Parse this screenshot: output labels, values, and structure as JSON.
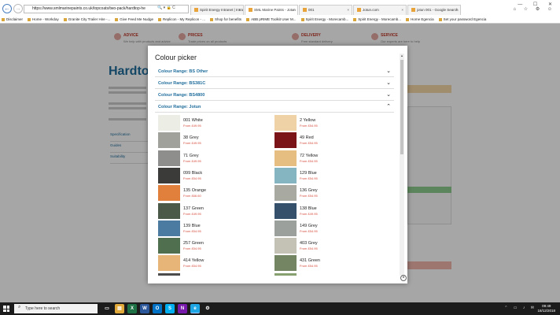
{
  "browser": {
    "url": "https://www.smlmarinepaints.co.uk/topcoats/two-pack/hardtop-he",
    "tabs": [
      {
        "label": "Spirit Energy Intranet | Intranet",
        "active": false
      },
      {
        "label": "SML Marine Paints - Jotun",
        "active": true
      },
      {
        "label": "001",
        "active": false
      },
      {
        "label": "Jotun.com",
        "active": false
      },
      {
        "label": "jotun 001 - Google Search",
        "active": false
      }
    ],
    "bookmarks": [
      "Disclaimer",
      "Home - Workday",
      "Granite City Trailer Hire -...",
      "Give Feed Me Nudge",
      "Replicon - My Replicon - ...",
      "Shop for benefits",
      "ABB pRIME Toolkit User M...",
      "Spirit Energy - Morecamb...",
      "Spirit Energy - Morecamb...",
      "Home Egencia",
      "Set your password Egencia"
    ]
  },
  "background_page": {
    "features": [
      {
        "title": "ADVICE",
        "desc": "We help with products and advice"
      },
      {
        "title": "PRICES",
        "desc": "Trade prices on all products"
      },
      {
        "title": "DELIVERY",
        "desc": "Free standard delivery"
      },
      {
        "title": "SERVICE",
        "desc": "Our experts are here to help"
      }
    ],
    "title": "Hardtop",
    "side_tabs": [
      "Specification",
      "Guides",
      "Suitability"
    ]
  },
  "modal": {
    "title": "Colour picker",
    "ranges": [
      {
        "label": "Colour Range: BS Other",
        "expanded": false
      },
      {
        "label": "Colour Range: BS381C",
        "expanded": false
      },
      {
        "label": "Colour Range: BS4800",
        "expanded": false
      },
      {
        "label": "Colour Range: Jotun",
        "expanded": true
      }
    ],
    "colours": [
      {
        "name": "001 White",
        "price": "From £49.95",
        "hex": "#ecede4"
      },
      {
        "name": "2 Yellow",
        "price": "From £54.95",
        "hex": "#efd3a6"
      },
      {
        "name": "38 Grey",
        "price": "From £49.95",
        "hex": "#9fa19a"
      },
      {
        "name": "49 Red",
        "price": "From £54.95",
        "hex": "#7a1418"
      },
      {
        "name": "71 Grey",
        "price": "From £49.95",
        "hex": "#8e8f8c"
      },
      {
        "name": "72 Yellow",
        "price": "From £54.95",
        "hex": "#e6be82"
      },
      {
        "name": "099 Black",
        "price": "From £54.95",
        "hex": "#3b3b39"
      },
      {
        "name": "129 Blue",
        "price": "From £54.95",
        "hex": "#85b5c0"
      },
      {
        "name": "135 Orange",
        "price": "From £66.60",
        "hex": "#e0803c"
      },
      {
        "name": "136 Grey",
        "price": "From £54.95",
        "hex": "#a8aaa2"
      },
      {
        "name": "137 Green",
        "price": "From £49.95",
        "hex": "#4b5a48"
      },
      {
        "name": "138 Blue",
        "price": "From £49.95",
        "hex": "#35506a"
      },
      {
        "name": "139 Blue",
        "price": "From £54.95",
        "hex": "#4b7ba1"
      },
      {
        "name": "149 Grey",
        "price": "From £54.95",
        "hex": "#9ba09c"
      },
      {
        "name": "257 Green",
        "price": "From £54.95",
        "hex": "#4f6f4e"
      },
      {
        "name": "403 Grey",
        "price": "From £54.95",
        "hex": "#c4c2b4"
      },
      {
        "name": "414 Yellow",
        "price": "From £54.95",
        "hex": "#e6b577"
      },
      {
        "name": "431 Green",
        "price": "From £54.95",
        "hex": "#748563"
      }
    ],
    "partial_hexes": [
      "#4c4c4c",
      "#86a06f"
    ],
    "close_label": "×"
  },
  "taskbar": {
    "search_placeholder": "Type here to search",
    "time": "09:49",
    "date": "18/12/2018",
    "apps": [
      {
        "name": "task-view-icon",
        "glyph": "▭",
        "color": "#1c1c1c"
      },
      {
        "name": "file-explorer-icon",
        "glyph": "▤",
        "color": "#e0a93a"
      },
      {
        "name": "excel-icon",
        "glyph": "X",
        "color": "#1e7145"
      },
      {
        "name": "word-icon",
        "glyph": "W",
        "color": "#2b579a"
      },
      {
        "name": "outlook-icon",
        "glyph": "O",
        "color": "#0072c6"
      },
      {
        "name": "skype-icon",
        "glyph": "S",
        "color": "#00aff0"
      },
      {
        "name": "onenote-icon",
        "glyph": "N",
        "color": "#7719aa"
      },
      {
        "name": "ie-icon",
        "glyph": "e",
        "color": "#1ea5e3"
      },
      {
        "name": "settings-icon",
        "glyph": "⚙",
        "color": "#1c1c1c"
      }
    ]
  }
}
